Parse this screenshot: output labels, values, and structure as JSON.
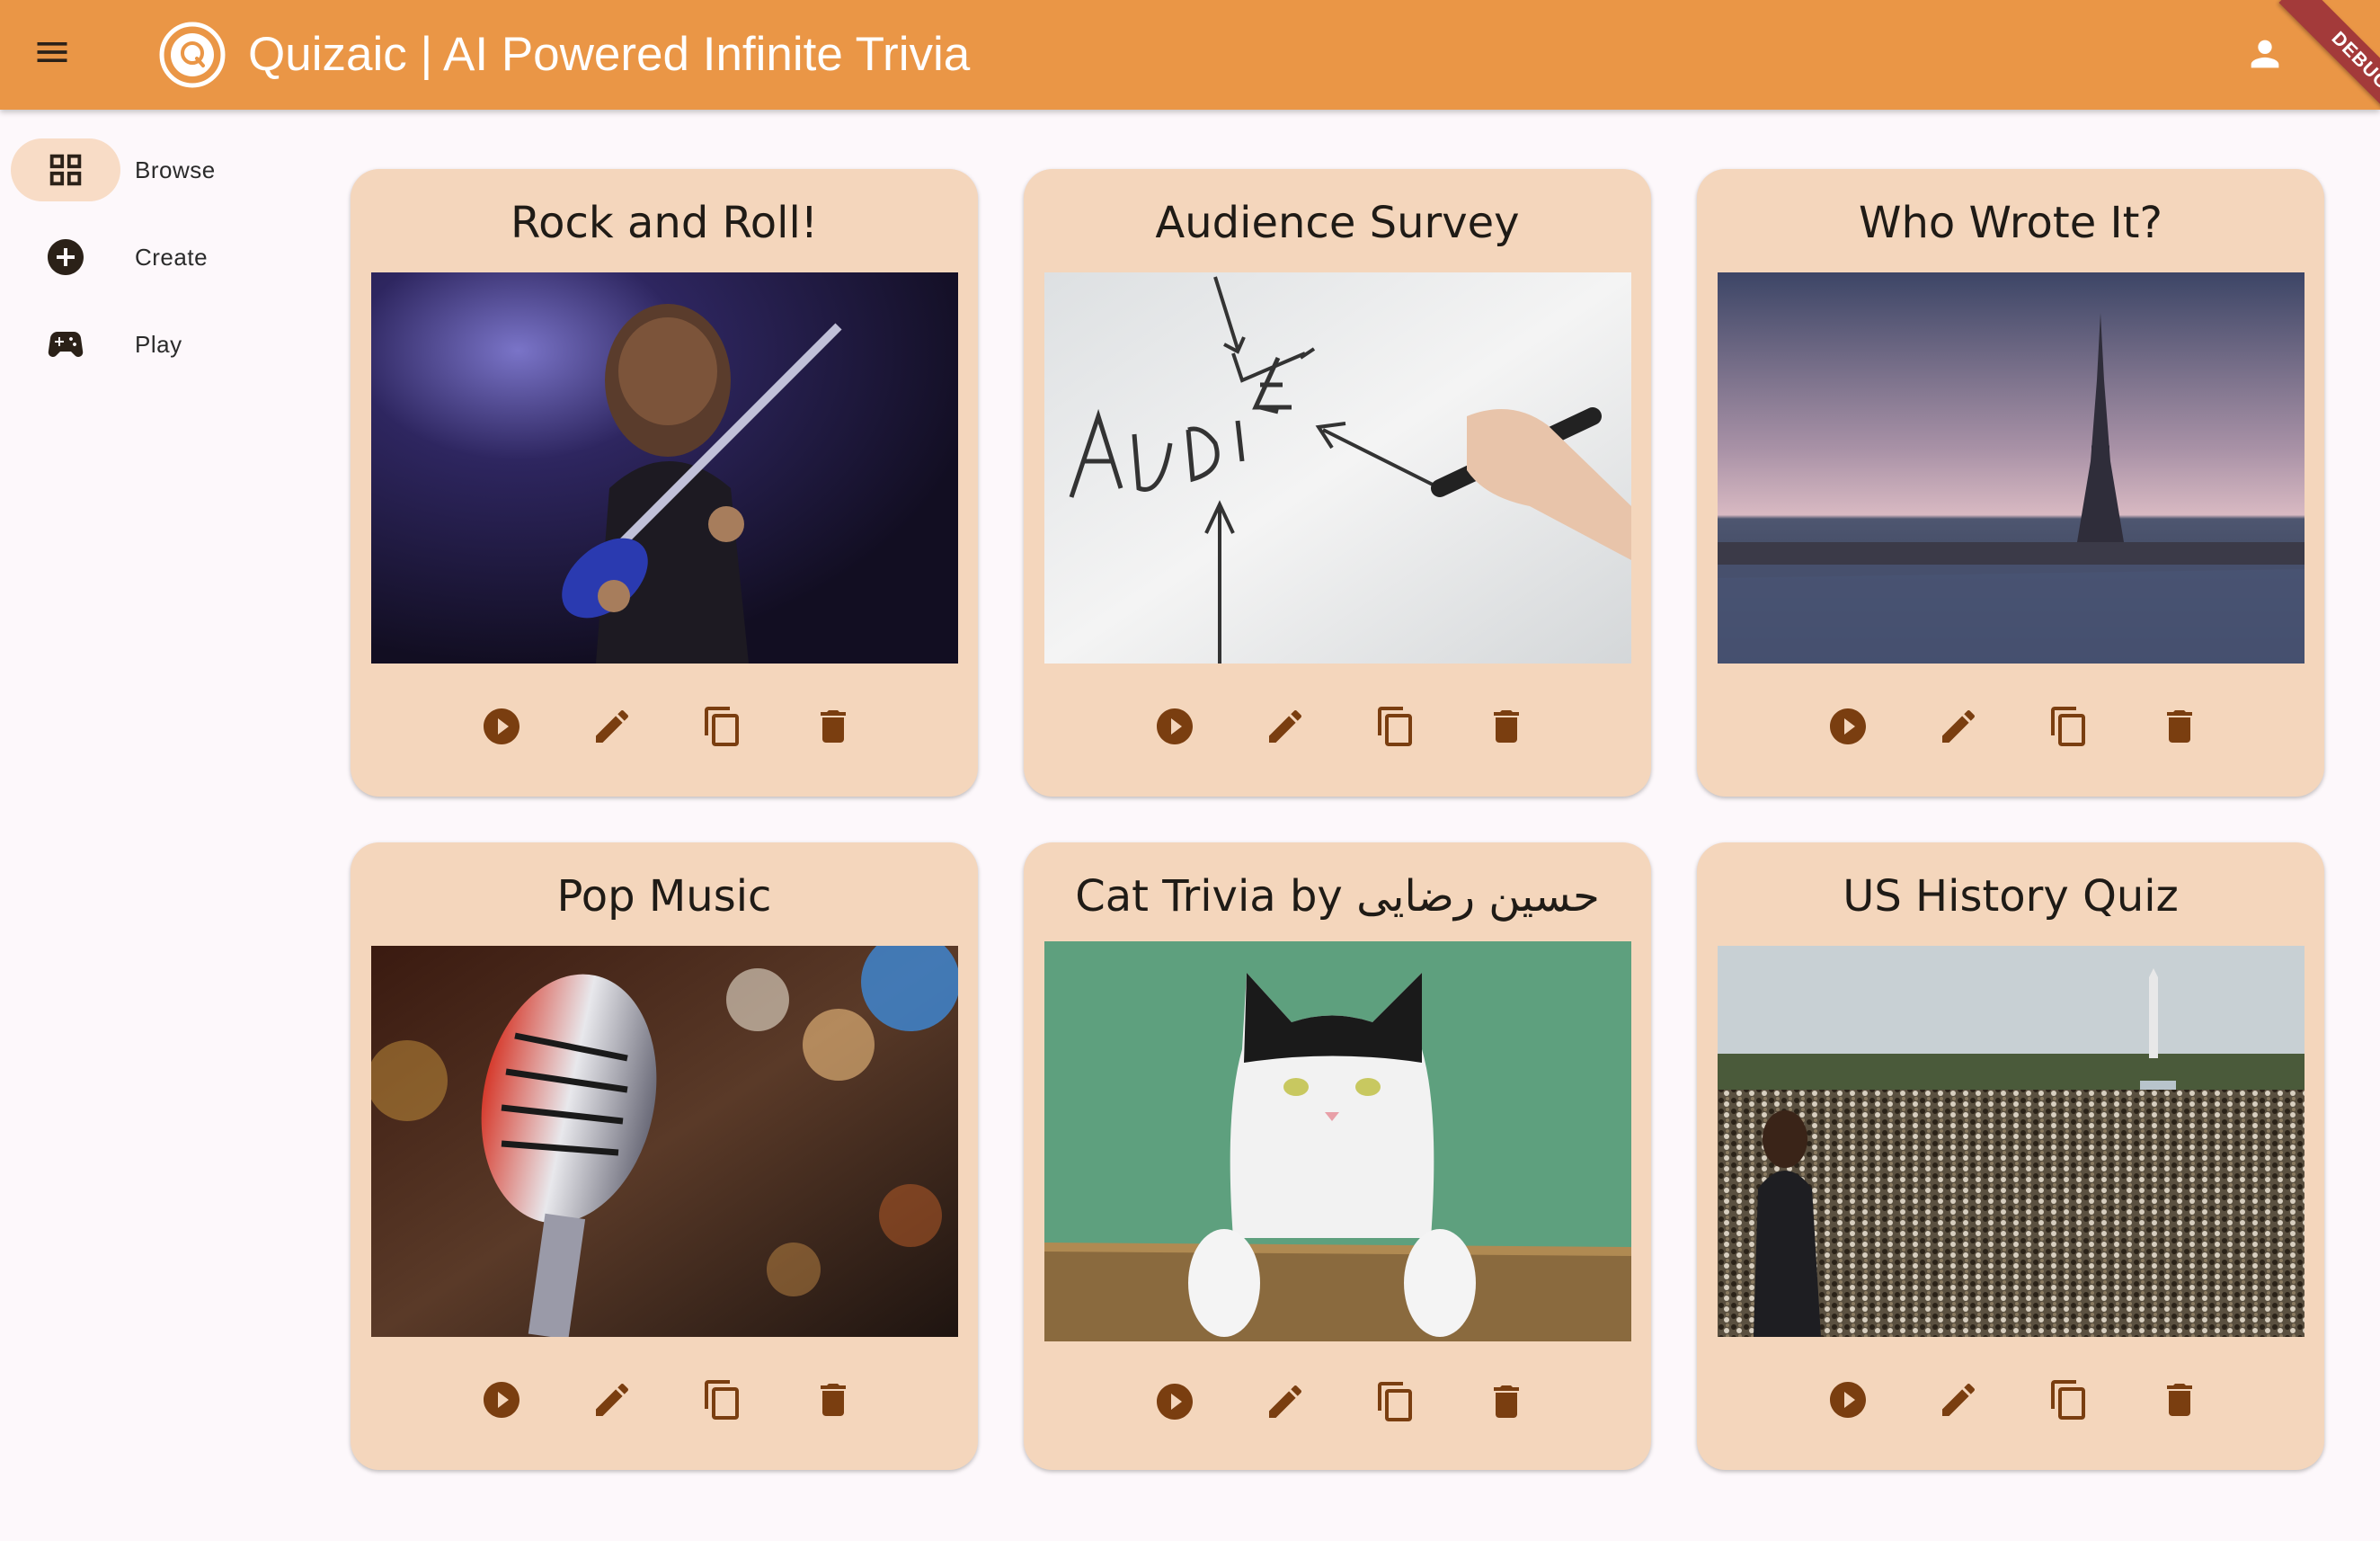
{
  "appbar": {
    "title": "Quizaic | AI Powered Infinite Trivia",
    "debug_label": "DEBUG",
    "menu_icon": "hamburger-menu-icon",
    "account_icon": "person-icon",
    "background_color": "#ea9646"
  },
  "rail": {
    "selected": "Browse",
    "items": [
      {
        "label": "Browse",
        "icon": "grid-view-icon"
      },
      {
        "label": "Create",
        "icon": "add-circle-icon"
      },
      {
        "label": "Play",
        "icon": "gamepad-icon"
      }
    ]
  },
  "cards": [
    {
      "title": "Rock and Roll!",
      "image": "guitarist-on-stage"
    },
    {
      "title": "Audience Survey",
      "image": "audience-whiteboard"
    },
    {
      "title": "Who Wrote It?",
      "image": "eiffel-tower-river"
    },
    {
      "title": "Pop Music",
      "image": "vintage-microphone"
    },
    {
      "title": "Cat Trivia by حسین رضایی",
      "image": "cat-on-basket"
    },
    {
      "title": "US History Quiz",
      "image": "washington-crowd"
    }
  ],
  "card_actions": [
    "play-icon",
    "edit-icon",
    "copy-icon",
    "delete-icon"
  ],
  "colors": {
    "card_background": "#f4d6bc",
    "icon_color": "#7a3e10",
    "rail_indicator": "#f8dcc6"
  }
}
